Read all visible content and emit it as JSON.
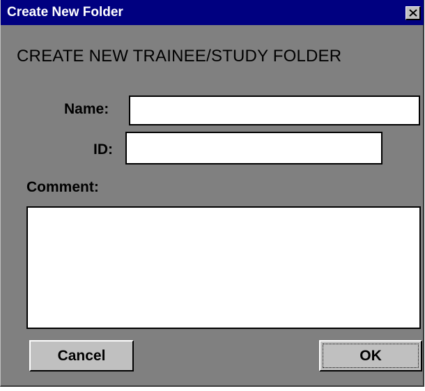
{
  "window": {
    "title": "Create New Folder",
    "close_icon": "close-x-icon"
  },
  "form": {
    "heading": "CREATE NEW TRAINEE/STUDY FOLDER",
    "name_label": "Name:",
    "name_value": "",
    "id_label": "ID:",
    "id_value": "",
    "comment_label": "Comment:",
    "comment_value": ""
  },
  "buttons": {
    "cancel_label": "Cancel",
    "ok_label": "OK"
  },
  "colors": {
    "titlebar": "#000080",
    "dialog_bg": "#808080",
    "button_bg": "#c0c0c0"
  }
}
